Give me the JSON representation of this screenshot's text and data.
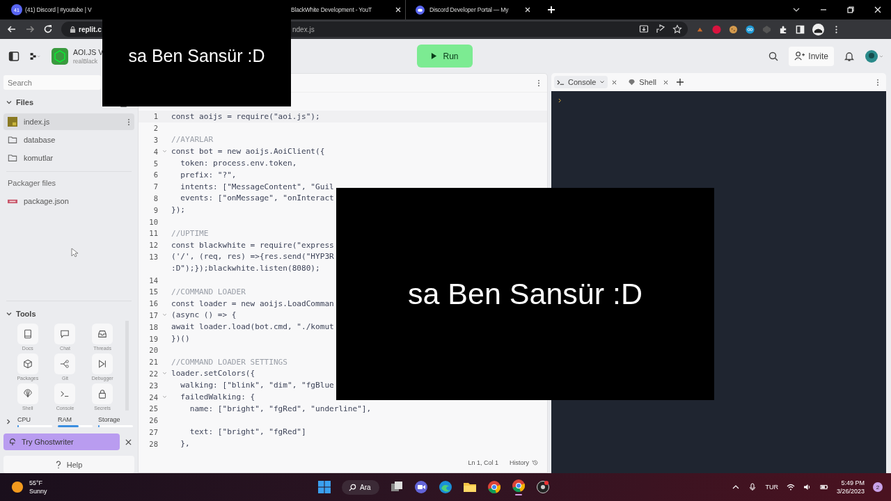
{
  "browser": {
    "tabs": [
      {
        "title": "(41) Discord | #youtube | V",
        "kind": "badge",
        "badge": "41",
        "selected": false,
        "closable": false
      },
      {
        "title": "BlackWhite Development - YouT",
        "kind": "plain",
        "selected": false,
        "closable": true
      },
      {
        "title": "Discord Developer Portal — My",
        "kind": "discord",
        "selected": false,
        "closable": true
      }
    ],
    "url_start": "replit.c",
    "url_end": "ndex.js"
  },
  "header": {
    "project_name": "AOI.JS V",
    "owner": "realBlack",
    "run_label": "Run",
    "invite_label": "Invite"
  },
  "sidebar": {
    "search_placeholder": "Search",
    "files_title": "Files",
    "files": [
      {
        "name": "index.js",
        "kind": "js",
        "selected": true
      },
      {
        "name": "database",
        "kind": "folder",
        "selected": false
      },
      {
        "name": "komutlar",
        "kind": "folder",
        "selected": false
      }
    ],
    "packager_title": "Packager files",
    "packager_files": [
      {
        "name": "package.json",
        "kind": "npm",
        "selected": false
      }
    ],
    "tools_title": "Tools",
    "tools": [
      {
        "label": "Docs"
      },
      {
        "label": "Chat"
      },
      {
        "label": "Threads"
      },
      {
        "label": "Packages"
      },
      {
        "label": "Git"
      },
      {
        "label": "Debugger"
      },
      {
        "label": "Shell"
      },
      {
        "label": "Console"
      },
      {
        "label": "Secrets"
      }
    ],
    "resources": [
      {
        "label": "CPU",
        "level": 0.03
      },
      {
        "label": "RAM",
        "level": 0.6
      },
      {
        "label": "Storage",
        "level": 0.03
      }
    ],
    "ghostwriter_label": "Try Ghostwriter",
    "help_label": "Help"
  },
  "editor": {
    "lines": [
      {
        "n": "1",
        "kind": "code",
        "fold": false,
        "text": "const aoijs = require(\"aoi.js\");"
      },
      {
        "n": "2",
        "kind": "blank",
        "fold": false
      },
      {
        "n": "3",
        "kind": "comment",
        "fold": false,
        "text": "//AYARLAR"
      },
      {
        "n": "4",
        "kind": "code",
        "fold": true,
        "text": "const bot = new aoijs.AoiClient({"
      },
      {
        "n": "5",
        "kind": "code",
        "fold": false,
        "text": "  token: process.env.token,"
      },
      {
        "n": "6",
        "kind": "code",
        "fold": false,
        "text": "  prefix: \"?\","
      },
      {
        "n": "7",
        "kind": "code",
        "fold": false,
        "text": "  intents: [\"MessageContent\", \"Guil"
      },
      {
        "n": "8",
        "kind": "code",
        "fold": false,
        "text": "  events: [\"onMessage\", \"onInteract"
      },
      {
        "n": "9",
        "kind": "code",
        "fold": false,
        "text": "});"
      },
      {
        "n": "10",
        "kind": "blank",
        "fold": false
      },
      {
        "n": "11",
        "kind": "comment",
        "fold": false,
        "text": "//UPTIME"
      },
      {
        "n": "12",
        "kind": "code",
        "fold": false,
        "text": "const blackwhite = require(\"express"
      },
      {
        "n": "13",
        "kind": "code",
        "fold": false,
        "text": "('/', (req, res) =>{res.send(\"HYP3R",
        "continuation": ":D\");});blackwhite.listen(8080);"
      },
      {
        "n": "14",
        "kind": "blank",
        "fold": false
      },
      {
        "n": "15",
        "kind": "comment",
        "fold": false,
        "text": "//COMMAND LOADER"
      },
      {
        "n": "16",
        "kind": "code",
        "fold": false,
        "text": "const loader = new aoijs.LoadComman"
      },
      {
        "n": "17",
        "kind": "code",
        "fold": true,
        "text": "(async () => {"
      },
      {
        "n": "18",
        "kind": "code",
        "fold": false,
        "text": "await loader.load(bot.cmd, \"./komut"
      },
      {
        "n": "19",
        "kind": "code",
        "fold": false,
        "text": "})()"
      },
      {
        "n": "20",
        "kind": "blank",
        "fold": false
      },
      {
        "n": "21",
        "kind": "comment",
        "fold": false,
        "text": "//COMMAND LOADER SETTINGS"
      },
      {
        "n": "22",
        "kind": "code",
        "fold": true,
        "text": "loader.setColors({"
      },
      {
        "n": "23",
        "kind": "code",
        "fold": false,
        "text": "  walking: [\"blink\", \"dim\", \"fgBlue"
      },
      {
        "n": "24",
        "kind": "code",
        "fold": true,
        "text": "  failedWalking: {"
      },
      {
        "n": "25",
        "kind": "code",
        "fold": false,
        "text": "    name: [\"bright\", \"fgRed\", \"underline\"],"
      },
      {
        "n": "26",
        "kind": "blank",
        "fold": false
      },
      {
        "n": "27",
        "kind": "code",
        "fold": false,
        "text": "    text: [\"bright\", \"fgRed\"]"
      },
      {
        "n": "28",
        "kind": "code",
        "fold": false,
        "text": "  },"
      }
    ],
    "cursor": "Ln 1, Col 1",
    "history_label": "History"
  },
  "console": {
    "tabs": [
      {
        "label": "Console",
        "selected": true
      },
      {
        "label": "Shell",
        "selected": false
      }
    ]
  },
  "taskbar": {
    "temperature": "55°F",
    "weather": "Sunny",
    "search_label": "Ara",
    "language": "TUR",
    "time": "5:49 PM",
    "date": "3/26/2023",
    "notifications": "2"
  },
  "overlays": [
    {
      "text": "sa Ben Sansür :D"
    },
    {
      "text": "sa Ben Sansür :D"
    }
  ]
}
